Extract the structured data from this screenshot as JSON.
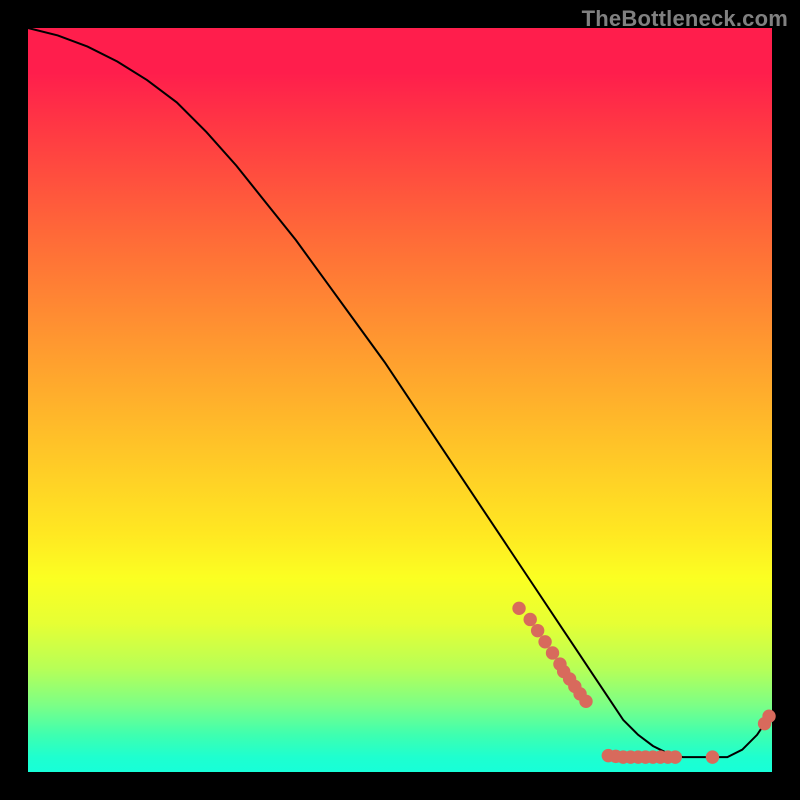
{
  "watermark": "TheBottleneck.com",
  "chart_data": {
    "type": "line",
    "title": "",
    "xlabel": "",
    "ylabel": "",
    "xlim": [
      0,
      100
    ],
    "ylim": [
      0,
      100
    ],
    "curve": {
      "name": "bottleneck-curve",
      "x": [
        0,
        4,
        8,
        12,
        16,
        20,
        24,
        28,
        32,
        36,
        40,
        44,
        48,
        52,
        56,
        60,
        64,
        68,
        72,
        74,
        76,
        78,
        80,
        82,
        84,
        86,
        88,
        90,
        92,
        94,
        96,
        98,
        100
      ],
      "y": [
        100,
        99,
        97.5,
        95.5,
        93,
        90,
        86,
        81.5,
        76.5,
        71.5,
        66,
        60.5,
        55,
        49,
        43,
        37,
        31,
        25,
        19,
        16,
        13,
        10,
        7,
        5,
        3.5,
        2.5,
        2,
        2,
        2,
        2,
        3,
        5,
        8
      ]
    },
    "markers": {
      "name": "sample-points",
      "color": "#d86a5c",
      "x": [
        66,
        67.5,
        68.5,
        69.5,
        70.5,
        71.5,
        72,
        72.8,
        73.5,
        74.2,
        75,
        78,
        79,
        80,
        81,
        82,
        83,
        84,
        85,
        86,
        87,
        92,
        99,
        99.6
      ],
      "y": [
        22,
        20.5,
        19,
        17.5,
        16,
        14.5,
        13.5,
        12.5,
        11.5,
        10.5,
        9.5,
        2.2,
        2.1,
        2.0,
        2.0,
        2.0,
        2.0,
        2.0,
        2.0,
        2.0,
        2.0,
        2.0,
        6.5,
        7.5
      ]
    }
  }
}
